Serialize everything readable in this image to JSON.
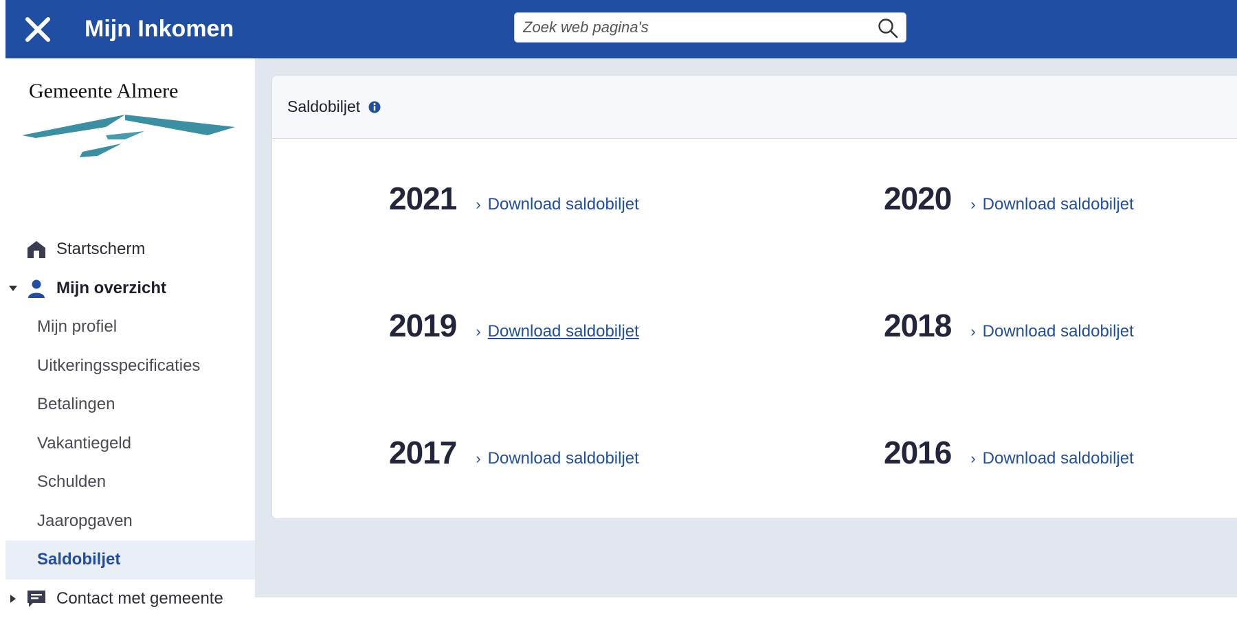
{
  "header": {
    "title": "Mijn Inkomen",
    "search_placeholder": "Zoek web pagina's"
  },
  "sidebar": {
    "brand": "Gemeente Almere",
    "nav": {
      "home": "Startscherm",
      "overview": "Mijn overzicht",
      "items": [
        "Mijn profiel",
        "Uitkeringsspecificaties",
        "Betalingen",
        "Vakantiegeld",
        "Schulden",
        "Jaaropgaven",
        "Saldobiljet"
      ],
      "contact": "Contact met gemeente"
    },
    "active_item": "Saldobiljet"
  },
  "card": {
    "title": "Saldobiljet",
    "years": [
      {
        "year": "2021",
        "link": "Download saldobiljet"
      },
      {
        "year": "2020",
        "link": "Download saldobiljet"
      },
      {
        "year": "2019",
        "link": "Download saldobiljet"
      },
      {
        "year": "2018",
        "link": "Download saldobiljet"
      },
      {
        "year": "2017",
        "link": "Download saldobiljet"
      },
      {
        "year": "2016",
        "link": "Download saldobiljet"
      }
    ]
  },
  "colors": {
    "brand_blue": "#1f4ea3",
    "logo_teal": "#3a8fa3",
    "main_bg": "#e2e6ef"
  }
}
